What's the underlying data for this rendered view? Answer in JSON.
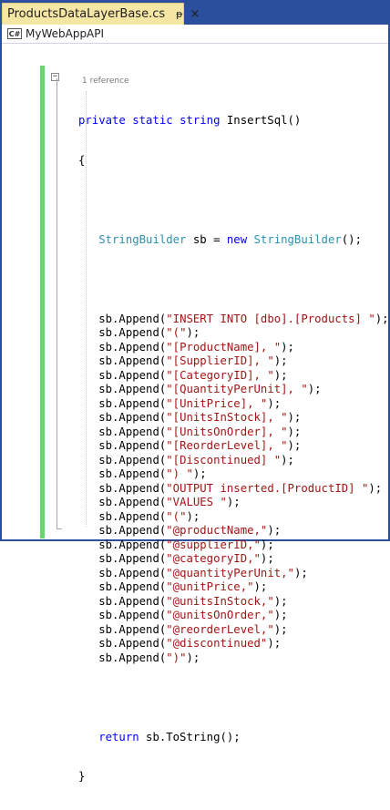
{
  "tab": {
    "title": "ProductsDataLayerBase.cs",
    "pin_glyph": "ᵽ",
    "close_glyph": "×"
  },
  "navbar": {
    "project_icon_text": "C#",
    "project_name": "MyWebAppAPI"
  },
  "codelens": "1 reference",
  "signature": {
    "kw1": "private",
    "kw2": "static",
    "kw3": "string",
    "name": "InsertSql()"
  },
  "open_brace": "{",
  "sb_decl": {
    "type": "StringBuilder",
    "mid": " sb = ",
    "kw": "new",
    "type2": "StringBuilder",
    "end": "();"
  },
  "appends": [
    "\"INSERT INTO [dbo].[Products] \"",
    "\"(\"",
    "\"[ProductName], \"",
    "\"[SupplierID], \"",
    "\"[CategoryID], \"",
    "\"[QuantityPerUnit], \"",
    "\"[UnitPrice], \"",
    "\"[UnitsInStock], \"",
    "\"[UnitsOnOrder], \"",
    "\"[ReorderLevel], \"",
    "\"[Discontinued] \"",
    "\") \"",
    "\"OUTPUT inserted.[ProductID] \"",
    "\"VALUES \"",
    "\"(\"",
    "\"@productName,\"",
    "\"@supplierID,\"",
    "\"@categoryID,\"",
    "\"@quantityPerUnit,\"",
    "\"@unitPrice,\"",
    "\"@unitsInStock,\"",
    "\"@unitsOnOrder,\"",
    "\"@reorderLevel,\"",
    "\"@discontinued\"",
    "\")\""
  ],
  "append_prefix": "sb.Append(",
  "append_suffix": ");",
  "return_stmt": {
    "kw": "return",
    "rest": " sb.ToString();"
  },
  "close_brace": "}",
  "colors": {
    "tab_bg": "#f5e6a3",
    "frame": "#2b4f9c",
    "keyword": "#0000ff",
    "type": "#2b91af",
    "string": "#a31515",
    "change_bar": "#6bd36b"
  }
}
